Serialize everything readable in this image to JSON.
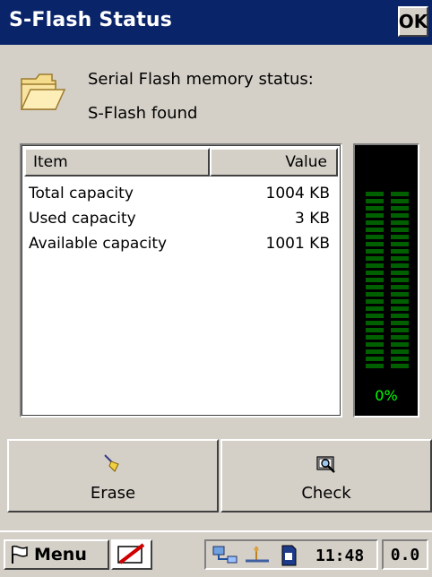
{
  "window": {
    "title": "S-Flash Status",
    "ok_label": "OK"
  },
  "status": {
    "icon": "folder-icon",
    "heading": "Serial Flash memory status:",
    "result": "S-Flash found"
  },
  "table": {
    "columns": [
      "Item",
      "Value"
    ],
    "rows": [
      {
        "item": "Total capacity",
        "value": "1004 KB"
      },
      {
        "item": "Used capacity",
        "value": "3 KB"
      },
      {
        "item": "Available capacity",
        "value": "1001 KB"
      }
    ]
  },
  "meter": {
    "percent_label": "0%",
    "level": 0,
    "segment_color": "#006000",
    "text_color": "#00ff00"
  },
  "buttons": {
    "erase": {
      "label": "Erase",
      "icon": "broom-icon"
    },
    "check": {
      "label": "Check",
      "icon": "magnifier-icon"
    }
  },
  "taskbar": {
    "menu_label": "Menu",
    "clock": "11:48",
    "rate": "0.0",
    "tray_icons": [
      "network-icon",
      "usb-icon",
      "sd-card-icon"
    ]
  },
  "colors": {
    "titlebar": "#0a246a",
    "face": "#d4d0c8"
  }
}
